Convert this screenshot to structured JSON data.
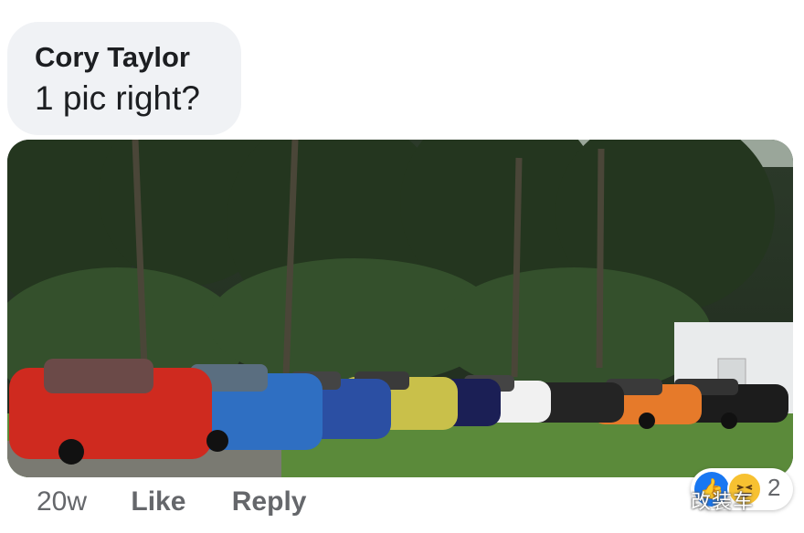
{
  "comment": {
    "author": "Cory Taylor",
    "text": "1 pic right?"
  },
  "photo": {
    "description_icon": "photo-of-cars"
  },
  "actions": {
    "time": "20w",
    "like_label": "Like",
    "reply_label": "Reply"
  },
  "reactions": {
    "count": "2",
    "icons": [
      "like-icon",
      "haha-icon"
    ]
  },
  "watermark": {
    "text": "改装车"
  },
  "colors": {
    "bubble_bg": "#f0f2f5",
    "meta_text": "#65676b",
    "like_blue": "#1877f2"
  }
}
